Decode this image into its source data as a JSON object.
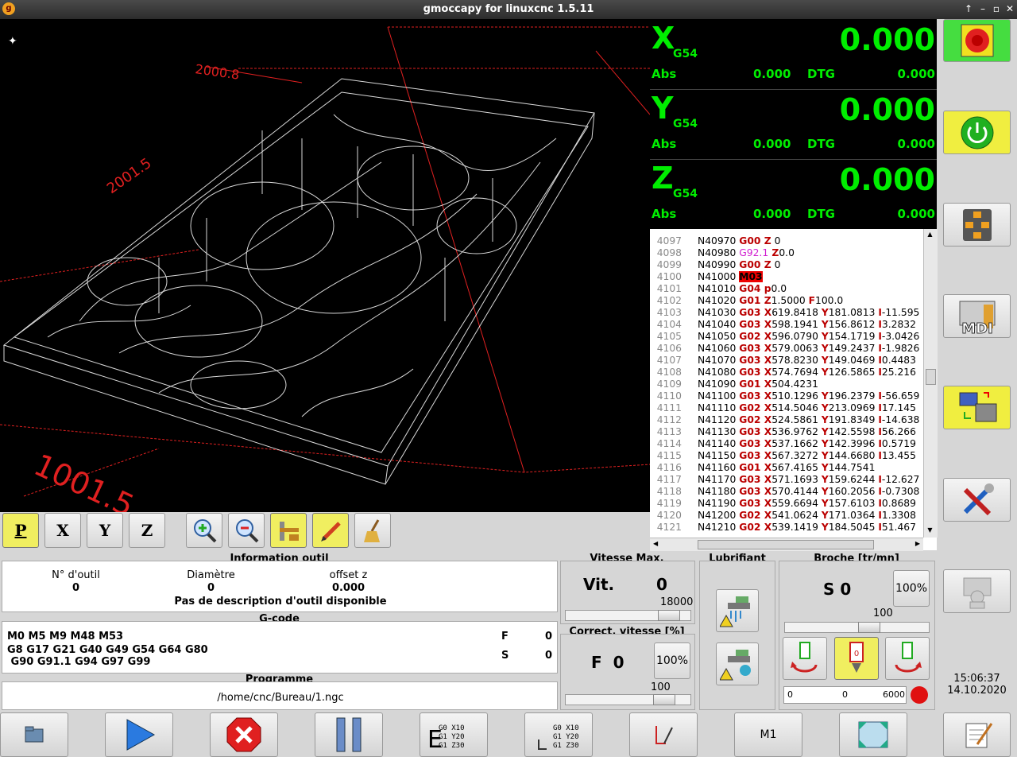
{
  "window": {
    "title": "gmoccapy for linuxcnc  1.5.11",
    "controls": [
      "↑",
      "–",
      "▫",
      "✕"
    ]
  },
  "preview": {
    "dim_top": "2000.8",
    "dim_left": "2001.5",
    "dim_bottom": "1001.5",
    "colors": {
      "bg": "#000000",
      "limits": "#e02020",
      "toolpath": "#ffffff"
    }
  },
  "view_buttons": [
    {
      "label": "P",
      "name": "view-p-button",
      "active": true
    },
    {
      "label": "X",
      "name": "view-x-button",
      "active": false
    },
    {
      "label": "Y",
      "name": "view-y-button",
      "active": false
    },
    {
      "label": "Z",
      "name": "view-z-button",
      "active": false
    }
  ],
  "preview_tools": [
    "zoom-in-icon",
    "zoom-out-icon",
    "measure-icon",
    "pencil-icon",
    "broom-icon"
  ],
  "dro": [
    {
      "axis": "X",
      "sys": "G54",
      "value": "0.000",
      "abs_label": "Abs",
      "abs": "0.000",
      "dtg_label": "DTG",
      "dtg": "0.000"
    },
    {
      "axis": "Y",
      "sys": "G54",
      "value": "0.000",
      "abs_label": "Abs",
      "abs": "0.000",
      "dtg_label": "DTG",
      "dtg": "0.000"
    },
    {
      "axis": "Z",
      "sys": "G54",
      "value": "0.000",
      "abs_label": "Abs",
      "abs": "0.000",
      "dtg_label": "DTG",
      "dtg": "0.000"
    }
  ],
  "gcode_lines": [
    {
      "ln": "4097",
      "t": [
        [
          "",
          "N40970 "
        ],
        [
          "b",
          "G00"
        ],
        [
          "b",
          " Z"
        ],
        [
          "",
          " 0"
        ]
      ]
    },
    {
      "ln": "4098",
      "t": [
        [
          "",
          "N40980 "
        ],
        [
          "mg",
          "G92.1"
        ],
        [
          "b",
          " Z"
        ],
        [
          "",
          "0.0"
        ]
      ]
    },
    {
      "ln": "4099",
      "t": [
        [
          "",
          "N40990 "
        ],
        [
          "b",
          "G00"
        ],
        [
          "b",
          " Z"
        ],
        [
          "",
          " 0"
        ]
      ]
    },
    {
      "ln": "4100",
      "t": [
        [
          "",
          "N41000 "
        ],
        [
          "hl",
          "M03"
        ]
      ]
    },
    {
      "ln": "4101",
      "t": [
        [
          "",
          "N41010 "
        ],
        [
          "b",
          "G04"
        ],
        [
          "b",
          " p"
        ],
        [
          "",
          "0.0"
        ]
      ]
    },
    {
      "ln": "4102",
      "t": [
        [
          "",
          "N41020 "
        ],
        [
          "b",
          "G01"
        ],
        [
          "b",
          " Z"
        ],
        [
          "",
          "1.5000 "
        ],
        [
          "b",
          "F"
        ],
        [
          "",
          "100.0"
        ]
      ]
    },
    {
      "ln": "4103",
      "t": [
        [
          "",
          "N41030 "
        ],
        [
          "b",
          "G03"
        ],
        [
          "b",
          " X"
        ],
        [
          "",
          "619.8418 "
        ],
        [
          "b",
          "Y"
        ],
        [
          "",
          "181.0813 "
        ],
        [
          "b",
          "I"
        ],
        [
          "",
          "-11.595"
        ]
      ]
    },
    {
      "ln": "4104",
      "t": [
        [
          "",
          "N41040 "
        ],
        [
          "b",
          "G03"
        ],
        [
          "b",
          " X"
        ],
        [
          "",
          "598.1941 "
        ],
        [
          "b",
          "Y"
        ],
        [
          "",
          "156.8612 "
        ],
        [
          "b",
          "I"
        ],
        [
          "",
          "3.2832"
        ]
      ]
    },
    {
      "ln": "4105",
      "t": [
        [
          "",
          "N41050 "
        ],
        [
          "b",
          "G02"
        ],
        [
          "b",
          " X"
        ],
        [
          "",
          "596.0790 "
        ],
        [
          "b",
          "Y"
        ],
        [
          "",
          "154.1719 "
        ],
        [
          "b",
          "I"
        ],
        [
          "",
          "-3.0426"
        ]
      ]
    },
    {
      "ln": "4106",
      "t": [
        [
          "",
          "N41060 "
        ],
        [
          "b",
          "G03"
        ],
        [
          "b",
          " X"
        ],
        [
          "",
          "579.0063 "
        ],
        [
          "b",
          "Y"
        ],
        [
          "",
          "149.2437 "
        ],
        [
          "b",
          "I"
        ],
        [
          "",
          "-1.9826"
        ]
      ]
    },
    {
      "ln": "4107",
      "t": [
        [
          "",
          "N41070 "
        ],
        [
          "b",
          "G03"
        ],
        [
          "b",
          " X"
        ],
        [
          "",
          "578.8230 "
        ],
        [
          "b",
          "Y"
        ],
        [
          "",
          "149.0469 "
        ],
        [
          "b",
          "I"
        ],
        [
          "",
          "0.4483"
        ]
      ]
    },
    {
      "ln": "4108",
      "t": [
        [
          "",
          "N41080 "
        ],
        [
          "b",
          "G03"
        ],
        [
          "b",
          " X"
        ],
        [
          "",
          "574.7694 "
        ],
        [
          "b",
          "Y"
        ],
        [
          "",
          "126.5865 "
        ],
        [
          "b",
          "I"
        ],
        [
          "",
          "25.216"
        ]
      ]
    },
    {
      "ln": "4109",
      "t": [
        [
          "",
          "N41090 "
        ],
        [
          "b",
          "G01"
        ],
        [
          "b",
          " X"
        ],
        [
          "",
          "504.4231"
        ]
      ]
    },
    {
      "ln": "4110",
      "t": [
        [
          "",
          "N41100 "
        ],
        [
          "b",
          "G03"
        ],
        [
          "b",
          " X"
        ],
        [
          "",
          "510.1296 "
        ],
        [
          "b",
          "Y"
        ],
        [
          "",
          "196.2379 "
        ],
        [
          "b",
          "I"
        ],
        [
          "",
          "-56.659"
        ]
      ]
    },
    {
      "ln": "4111",
      "t": [
        [
          "",
          "N41110 "
        ],
        [
          "b",
          "G02"
        ],
        [
          "b",
          " X"
        ],
        [
          "",
          "514.5046 "
        ],
        [
          "b",
          "Y"
        ],
        [
          "",
          "213.0969 "
        ],
        [
          "b",
          "I"
        ],
        [
          "",
          "17.145"
        ]
      ]
    },
    {
      "ln": "4112",
      "t": [
        [
          "",
          "N41120 "
        ],
        [
          "b",
          "G02"
        ],
        [
          "b",
          " X"
        ],
        [
          "",
          "524.5861 "
        ],
        [
          "b",
          "Y"
        ],
        [
          "",
          "191.8349 "
        ],
        [
          "b",
          "I"
        ],
        [
          "",
          "-14.638"
        ]
      ]
    },
    {
      "ln": "4113",
      "t": [
        [
          "",
          "N41130 "
        ],
        [
          "b",
          "G03"
        ],
        [
          "b",
          " X"
        ],
        [
          "",
          "536.9762 "
        ],
        [
          "b",
          "Y"
        ],
        [
          "",
          "142.5598 "
        ],
        [
          "b",
          "I"
        ],
        [
          "",
          "56.266"
        ]
      ]
    },
    {
      "ln": "4114",
      "t": [
        [
          "",
          "N41140 "
        ],
        [
          "b",
          "G03"
        ],
        [
          "b",
          " X"
        ],
        [
          "",
          "537.1662 "
        ],
        [
          "b",
          "Y"
        ],
        [
          "",
          "142.3996 "
        ],
        [
          "b",
          "I"
        ],
        [
          "",
          "0.5719"
        ]
      ]
    },
    {
      "ln": "4115",
      "t": [
        [
          "",
          "N41150 "
        ],
        [
          "b",
          "G03"
        ],
        [
          "b",
          " X"
        ],
        [
          "",
          "567.3272 "
        ],
        [
          "b",
          "Y"
        ],
        [
          "",
          "144.6680 "
        ],
        [
          "b",
          "I"
        ],
        [
          "",
          "13.455"
        ]
      ]
    },
    {
      "ln": "4116",
      "t": [
        [
          "",
          "N41160 "
        ],
        [
          "b",
          "G01"
        ],
        [
          "b",
          " X"
        ],
        [
          "",
          "567.4165 "
        ],
        [
          "b",
          "Y"
        ],
        [
          "",
          "144.7541"
        ]
      ]
    },
    {
      "ln": "4117",
      "t": [
        [
          "",
          "N41170 "
        ],
        [
          "b",
          "G03"
        ],
        [
          "b",
          " X"
        ],
        [
          "",
          "571.1693 "
        ],
        [
          "b",
          "Y"
        ],
        [
          "",
          "159.6244 "
        ],
        [
          "b",
          "I"
        ],
        [
          "",
          "-12.627"
        ]
      ]
    },
    {
      "ln": "4118",
      "t": [
        [
          "",
          "N41180 "
        ],
        [
          "b",
          "G03"
        ],
        [
          "b",
          " X"
        ],
        [
          "",
          "570.4144 "
        ],
        [
          "b",
          "Y"
        ],
        [
          "",
          "160.2056 "
        ],
        [
          "b",
          "I"
        ],
        [
          "",
          "-0.7308"
        ]
      ]
    },
    {
      "ln": "4119",
      "t": [
        [
          "",
          "N41190 "
        ],
        [
          "b",
          "G03"
        ],
        [
          "b",
          " X"
        ],
        [
          "",
          "559.6694 "
        ],
        [
          "b",
          "Y"
        ],
        [
          "",
          "157.6103 "
        ],
        [
          "b",
          "I"
        ],
        [
          "",
          "0.8689"
        ]
      ]
    },
    {
      "ln": "4120",
      "t": [
        [
          "",
          "N41200 "
        ],
        [
          "b",
          "G02"
        ],
        [
          "b",
          " X"
        ],
        [
          "",
          "541.0624 "
        ],
        [
          "b",
          "Y"
        ],
        [
          "",
          "171.0364 "
        ],
        [
          "b",
          "I"
        ],
        [
          "",
          "1.3308"
        ]
      ]
    },
    {
      "ln": "4121",
      "t": [
        [
          "",
          "N41210 "
        ],
        [
          "b",
          "G02"
        ],
        [
          "b",
          " X"
        ],
        [
          "",
          "539.1419 "
        ],
        [
          "b",
          "Y"
        ],
        [
          "",
          "184.5045 "
        ],
        [
          "b",
          "I"
        ],
        [
          "",
          "51.467"
        ]
      ]
    }
  ],
  "tool_info": {
    "title": "Information outil",
    "tool_no_label": "N° d'outil",
    "tool_no": "0",
    "diam_label": "Diamètre",
    "diam": "0",
    "offset_label": "offset z",
    "offset": "0.000",
    "desc": "Pas de description d'outil disponible"
  },
  "gcode_info": {
    "title": "G-code",
    "line1": "M0 M5 M9 M48 M53",
    "line2": "G8 G17 G21 G40 G49 G54 G64 G80",
    "line3": " G90 G91.1 G94 G97 G99",
    "f_label": "F",
    "f": "0",
    "s_label": "S",
    "s": "0"
  },
  "program": {
    "title": "Programme",
    "path": "/home/cnc/Bureau/1.ngc"
  },
  "max_vel": {
    "title": "Vitesse Max.",
    "label": "Vit.",
    "value": "0",
    "max": "18000",
    "fill": 0.9
  },
  "feed_override": {
    "title": "Correct. vitesse [%]",
    "label": "F  0",
    "pct": "100%",
    "scale": "100",
    "fill": 0.85
  },
  "coolant": {
    "title": "Lubrifiant"
  },
  "spindle": {
    "title": "Broche [tr/mn]",
    "speed": "S 0",
    "pct": "100%",
    "scale": "100",
    "fill": 0.6,
    "bar_min": "0",
    "bar_value": "0",
    "bar_max": "6000"
  },
  "clock": {
    "time": "15:06:37",
    "date": "14.10.2020"
  },
  "bottom_buttons": [
    "open-file-button",
    "run-button",
    "stop-button",
    "pause-button",
    "step-button",
    "run-from-line-button",
    "optional-block-button",
    "m1-button",
    "fullscreen-button"
  ],
  "m1_label": "M1",
  "edit_mode_lines": [
    "G0 X10",
    "G1 Y20",
    "G1 Z30"
  ]
}
